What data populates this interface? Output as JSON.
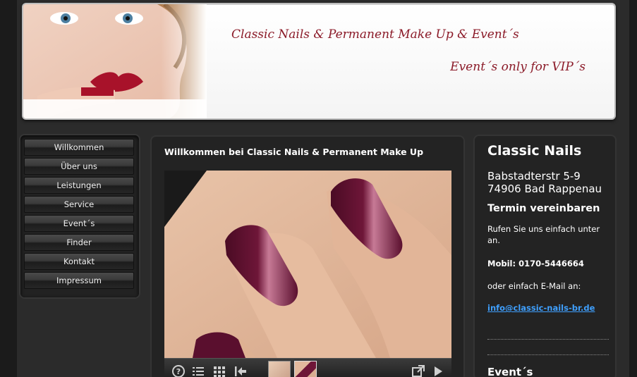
{
  "header": {
    "title": "Classic Nails & Permanent Make Up & Event´s",
    "subtitle": "Event´s only for VIP´s"
  },
  "nav": {
    "items": [
      {
        "label": "Willkommen"
      },
      {
        "label": "Über uns"
      },
      {
        "label": "Leistungen"
      },
      {
        "label": "Service"
      },
      {
        "label": "Event´s"
      },
      {
        "label": "Finder"
      },
      {
        "label": "Kontakt"
      },
      {
        "label": "Impressum"
      }
    ]
  },
  "main": {
    "title": "Willkommen bei Classic Nails & Permanent Make Up"
  },
  "info": {
    "name": "Classic Nails",
    "street": "Babstadterstr 5-9",
    "city": "74906 Bad Rappenau",
    "appointment_heading": "Termin vereinbaren",
    "call_text": "Rufen Sie uns einfach unter an.",
    "mobile": "Mobil: 0170-5446664",
    "email_text": "oder einfach E-Mail an:",
    "email": "info@classic-nails-br.de",
    "events_heading": "Event´s"
  },
  "colors": {
    "title_red": "#8b1a28",
    "nail_polish": "#5a0f2e",
    "link_blue": "#3fa0ff"
  }
}
